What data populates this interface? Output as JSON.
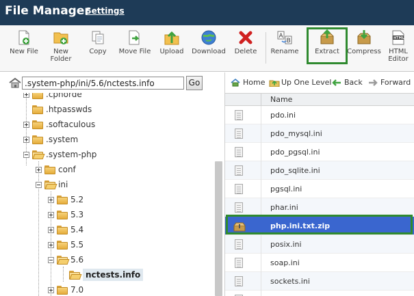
{
  "header": {
    "title": "File Manager",
    "settings_link": "Settings"
  },
  "toolbar": {
    "buttons": [
      {
        "label": "New File",
        "icon": "new-file-icon"
      },
      {
        "label": "New\nFolder",
        "icon": "new-folder-icon"
      },
      {
        "label": "Copy",
        "icon": "copy-icon"
      },
      {
        "label": "Move File",
        "icon": "move-file-icon"
      },
      {
        "label": "Upload",
        "icon": "upload-icon"
      },
      {
        "label": "Download",
        "icon": "download-icon"
      },
      {
        "label": "Delete",
        "icon": "delete-icon"
      },
      {
        "label": "Rename",
        "icon": "rename-icon"
      },
      {
        "label": "Extract",
        "icon": "extract-icon"
      },
      {
        "label": "Compress",
        "icon": "compress-icon"
      },
      {
        "label": "HTML\nEditor",
        "icon": "html-editor-icon"
      }
    ],
    "highlighted": "Extract",
    "highlight_color": "#2f8a2f"
  },
  "path": {
    "value": ".system-php/ini/5.6/nctests.info",
    "go_label": "Go"
  },
  "tree": {
    "items": [
      {
        "label": ".cphorde",
        "state": "collapsed"
      },
      {
        "label": ".htpasswds",
        "state": "leaf"
      },
      {
        "label": ".softaculous",
        "state": "collapsed"
      },
      {
        "label": ".system",
        "state": "collapsed"
      },
      {
        "label": ".system-php",
        "state": "expanded"
      },
      {
        "label": "conf",
        "state": "collapsed"
      },
      {
        "label": "ini",
        "state": "expanded"
      },
      {
        "label": "5.2",
        "state": "collapsed"
      },
      {
        "label": "5.3",
        "state": "collapsed"
      },
      {
        "label": "5.4",
        "state": "collapsed"
      },
      {
        "label": "5.5",
        "state": "collapsed"
      },
      {
        "label": "5.6",
        "state": "expanded"
      },
      {
        "label": "nctests.info",
        "state": "selected"
      },
      {
        "label": "7.0",
        "state": "collapsed"
      }
    ]
  },
  "nav": {
    "home": "Home",
    "up": "Up One Level",
    "back": "Back",
    "forward": "Forward"
  },
  "files": {
    "column_name": "Name",
    "rows": [
      {
        "name": "pdo.ini",
        "type": "file"
      },
      {
        "name": "pdo_mysql.ini",
        "type": "file"
      },
      {
        "name": "pdo_pgsql.ini",
        "type": "file"
      },
      {
        "name": "pdo_sqlite.ini",
        "type": "file"
      },
      {
        "name": "pgsql.ini",
        "type": "file"
      },
      {
        "name": "phar.ini",
        "type": "file"
      },
      {
        "name": "php.ini.txt.zip",
        "type": "zip",
        "selected": true
      },
      {
        "name": "posix.ini",
        "type": "file"
      },
      {
        "name": "soap.ini",
        "type": "file"
      },
      {
        "name": "sockets.ini",
        "type": "file"
      },
      {
        "name": "",
        "type": "file"
      }
    ],
    "selected_color": "#3a66cf"
  }
}
